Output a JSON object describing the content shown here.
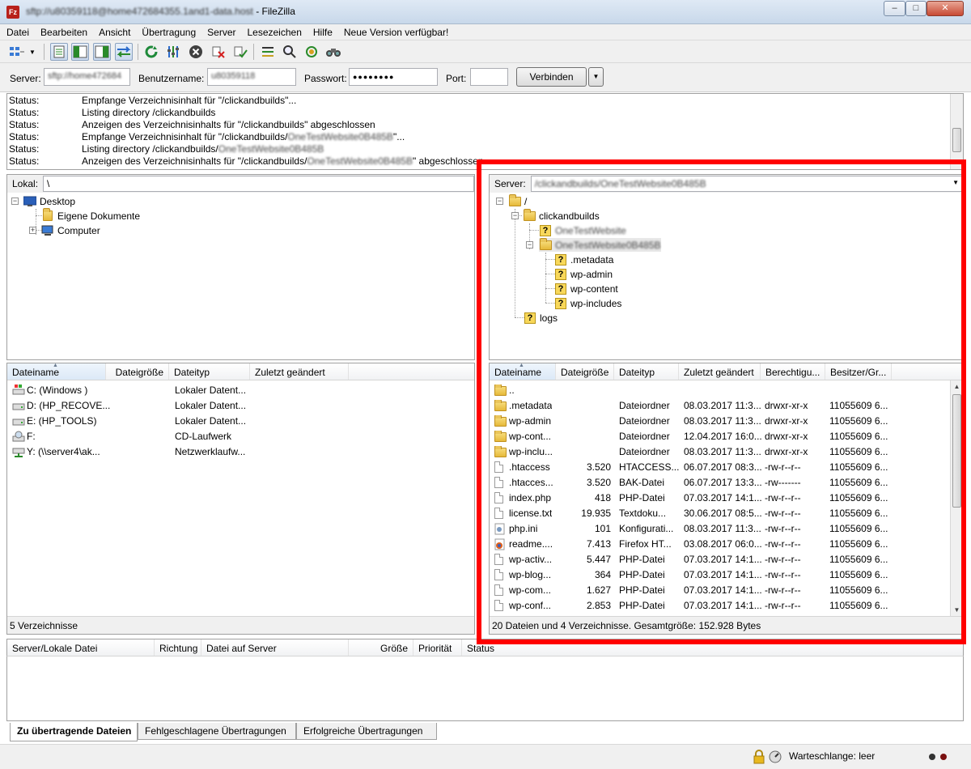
{
  "window": {
    "title_prefix": "sftp://u80359118@home472684355.1and1-data.host",
    "title_suffix": " - FileZilla",
    "app_icon": "filezilla-icon",
    "controls": {
      "minimize": "‒",
      "maximize": "□",
      "close": "✕"
    }
  },
  "menu": [
    "Datei",
    "Bearbeiten",
    "Ansicht",
    "Übertragung",
    "Server",
    "Lesezeichen",
    "Hilfe",
    "Neue Version verfügbar!"
  ],
  "toolbar": {
    "icons": [
      "site-manager-icon",
      "dropdown-icon",
      "toggle-log-icon",
      "toggle-local-tree-icon",
      "toggle-remote-tree-icon",
      "toggle-queue-icon",
      "refresh-icon",
      "process-queue-icon",
      "cancel-icon",
      "disconnect-icon",
      "reconnect-icon",
      "directory-compare-icon",
      "filter-icon",
      "sync-browse-icon",
      "search-icon"
    ]
  },
  "quickconnect": {
    "server_label": "Server:",
    "server_value": "sftp://home472684",
    "user_label": "Benutzername:",
    "user_value": "u80359118",
    "pass_label": "Passwort:",
    "pass_value": "●●●●●●●●",
    "port_label": "Port:",
    "port_value": "",
    "connect_label": "Verbinden",
    "dropdown": "▼"
  },
  "log": [
    {
      "label": "Status:",
      "text": "Empfange Verzeichnisinhalt für \"/clickandbuilds\"...",
      "blur": "",
      "tail": ""
    },
    {
      "label": "Status:",
      "text": "Listing directory /clickandbuilds",
      "blur": "",
      "tail": ""
    },
    {
      "label": "Status:",
      "text": "Anzeigen des Verzeichnisinhalts für \"/clickandbuilds\" abgeschlossen",
      "blur": "",
      "tail": ""
    },
    {
      "label": "Status:",
      "text": "Empfange Verzeichnisinhalt für \"/clickandbuilds/",
      "blur": "OneTestWebsite0B485B",
      "tail": "\"..."
    },
    {
      "label": "Status:",
      "text": "Listing directory /clickandbuilds/",
      "blur": "OneTestWebsite0B485B",
      "tail": ""
    },
    {
      "label": "Status:",
      "text": "Anzeigen des Verzeichnisinhalts für \"/clickandbuilds/",
      "blur": "OneTestWebsite0B485B",
      "tail": "\" abgeschlossen"
    }
  ],
  "local": {
    "path_label": "Lokal:",
    "path_value": "\\",
    "tree": [
      {
        "label": "Desktop",
        "icon": "desktop-icon"
      },
      {
        "label": "Eigene Dokumente",
        "icon": "documents-icon"
      },
      {
        "label": "Computer",
        "icon": "computer-icon"
      }
    ],
    "columns": [
      "Dateiname",
      "Dateigröße",
      "Dateityp",
      "Zuletzt geändert"
    ],
    "rows": [
      {
        "name": "C: (Windows )",
        "type": "Lokaler Datent...",
        "icon": "windows-drive-icon"
      },
      {
        "name": "D: (HP_RECOVE...",
        "type": "Lokaler Datent...",
        "icon": "drive-icon"
      },
      {
        "name": "E: (HP_TOOLS)",
        "type": "Lokaler Datent...",
        "icon": "drive-icon"
      },
      {
        "name": "F:",
        "type": "CD-Laufwerk",
        "icon": "cd-drive-icon"
      },
      {
        "name": "Y: (\\\\server4\\ak...",
        "type": "Netzwerklaufw...",
        "icon": "network-drive-icon"
      }
    ],
    "status": "5 Verzeichnisse"
  },
  "remote": {
    "path_label": "Server:",
    "path_value": "/clickandbuilds/OneTestWebsite0B485B",
    "tree": [
      {
        "label": "/",
        "kind": "folder"
      },
      {
        "label": "clickandbuilds",
        "kind": "folder"
      },
      {
        "label": "OneTestWebsite",
        "kind": "unknown",
        "blurred": true
      },
      {
        "label": "OneTestWebsite0B485B",
        "kind": "folder",
        "blurred": true
      },
      {
        "label": ".metadata",
        "kind": "unknown"
      },
      {
        "label": "wp-admin",
        "kind": "unknown"
      },
      {
        "label": "wp-content",
        "kind": "unknown"
      },
      {
        "label": "wp-includes",
        "kind": "unknown"
      },
      {
        "label": "logs",
        "kind": "unknown"
      }
    ],
    "columns": [
      "Dateiname",
      "Dateigröße",
      "Dateityp",
      "Zuletzt geändert",
      "Berechtigu...",
      "Besitzer/Gr..."
    ],
    "rows": [
      {
        "name": "..",
        "size": "",
        "type": "",
        "modified": "",
        "perm": "",
        "owner": "",
        "icon": "folder"
      },
      {
        "name": ".metadata",
        "size": "",
        "type": "Dateiordner",
        "modified": "08.03.2017 11:3...",
        "perm": "drwxr-xr-x",
        "owner": "11055609 6...",
        "icon": "folder"
      },
      {
        "name": "wp-admin",
        "size": "",
        "type": "Dateiordner",
        "modified": "08.03.2017 11:3...",
        "perm": "drwxr-xr-x",
        "owner": "11055609 6...",
        "icon": "folder"
      },
      {
        "name": "wp-cont...",
        "size": "",
        "type": "Dateiordner",
        "modified": "12.04.2017 16:0...",
        "perm": "drwxr-xr-x",
        "owner": "11055609 6...",
        "icon": "folder"
      },
      {
        "name": "wp-inclu...",
        "size": "",
        "type": "Dateiordner",
        "modified": "08.03.2017 11:3...",
        "perm": "drwxr-xr-x",
        "owner": "11055609 6...",
        "icon": "folder"
      },
      {
        "name": ".htaccess",
        "size": "3.520",
        "type": "HTACCESS...",
        "modified": "06.07.2017 08:3...",
        "perm": "-rw-r--r--",
        "owner": "11055609 6...",
        "icon": "file"
      },
      {
        "name": ".htacces...",
        "size": "3.520",
        "type": "BAK-Datei",
        "modified": "06.07.2017 13:3...",
        "perm": "-rw-------",
        "owner": "11055609 6...",
        "icon": "file"
      },
      {
        "name": "index.php",
        "size": "418",
        "type": "PHP-Datei",
        "modified": "07.03.2017 14:1...",
        "perm": "-rw-r--r--",
        "owner": "11055609 6...",
        "icon": "file"
      },
      {
        "name": "license.txt",
        "size": "19.935",
        "type": "Textdoku...",
        "modified": "30.06.2017 08:5...",
        "perm": "-rw-r--r--",
        "owner": "11055609 6...",
        "icon": "file"
      },
      {
        "name": "php.ini",
        "size": "101",
        "type": "Konfigurati...",
        "modified": "08.03.2017 11:3...",
        "perm": "-rw-r--r--",
        "owner": "11055609 6...",
        "icon": "config"
      },
      {
        "name": "readme....",
        "size": "7.413",
        "type": "Firefox HT...",
        "modified": "03.08.2017 06:0...",
        "perm": "-rw-r--r--",
        "owner": "11055609 6...",
        "icon": "firefox"
      },
      {
        "name": "wp-activ...",
        "size": "5.447",
        "type": "PHP-Datei",
        "modified": "07.03.2017 14:1...",
        "perm": "-rw-r--r--",
        "owner": "11055609 6...",
        "icon": "file"
      },
      {
        "name": "wp-blog...",
        "size": "364",
        "type": "PHP-Datei",
        "modified": "07.03.2017 14:1...",
        "perm": "-rw-r--r--",
        "owner": "11055609 6...",
        "icon": "file"
      },
      {
        "name": "wp-com...",
        "size": "1.627",
        "type": "PHP-Datei",
        "modified": "07.03.2017 14:1...",
        "perm": "-rw-r--r--",
        "owner": "11055609 6...",
        "icon": "file"
      },
      {
        "name": "wp-conf...",
        "size": "2.853",
        "type": "PHP-Datei",
        "modified": "07.03.2017 14:1...",
        "perm": "-rw-r--r--",
        "owner": "11055609 6...",
        "icon": "file"
      }
    ],
    "status": "20 Dateien und 4 Verzeichnisse. Gesamtgröße: 152.928 Bytes"
  },
  "queue": {
    "columns": [
      "Server/Lokale Datei",
      "Richtung",
      "Datei auf Server",
      "Größe",
      "Priorität",
      "Status"
    ],
    "tabs": [
      "Zu übertragende Dateien",
      "Fehlgeschlagene Übertragungen",
      "Erfolgreiche Übertragungen"
    ],
    "status": "Warteschlange: leer"
  },
  "highlight_color": "#ff0000"
}
